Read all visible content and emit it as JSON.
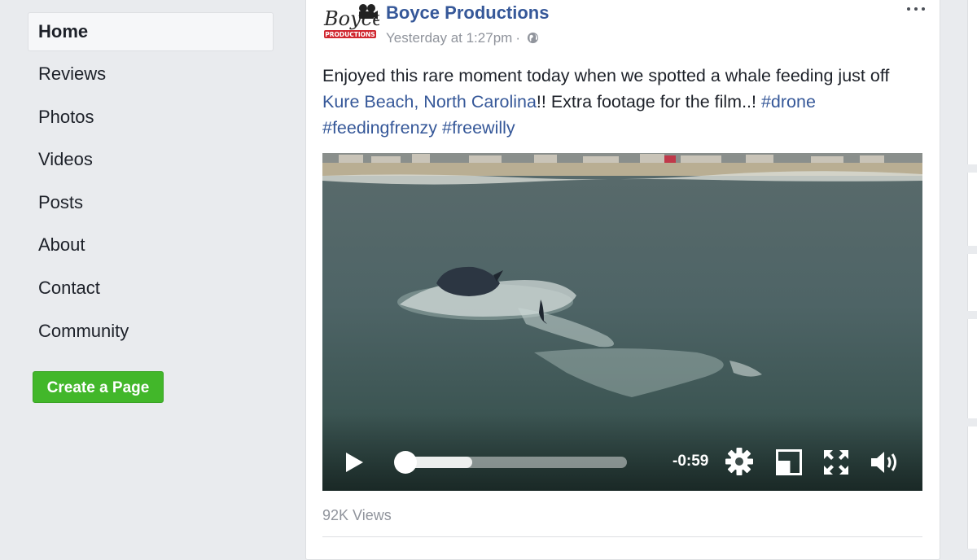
{
  "sidebar": {
    "items": [
      {
        "label": "Home",
        "active": true
      },
      {
        "label": "Reviews"
      },
      {
        "label": "Photos"
      },
      {
        "label": "Videos"
      },
      {
        "label": "Posts"
      },
      {
        "label": "About"
      },
      {
        "label": "Contact"
      },
      {
        "label": "Community"
      }
    ],
    "create_page_label": "Create a Page"
  },
  "post": {
    "page_name": "Boyce Productions",
    "timestamp": "Yesterday at 1:27pm",
    "separator": "·",
    "privacy_icon": "globe-icon",
    "more_icon": "more-options-icon",
    "text_before": "Enjoyed this rare moment today when we spotted a whale feeding just off ",
    "location_link": "Kure Beach, North Carolina",
    "text_after": "!! Extra footage for the film..! ",
    "hashtags": [
      "#drone",
      "#feedingfrenzy",
      "#freewilly"
    ],
    "avatar": {
      "line1": "Boyce",
      "line2": "PRODUCTIONS",
      "icon": "film-camera-icon"
    }
  },
  "video": {
    "time_remaining": "-0:59",
    "progress": 0.0,
    "buffered": 0.3,
    "icons": [
      "play-icon",
      "settings-gear-icon",
      "pop-out-icon",
      "fullscreen-icon",
      "volume-icon"
    ]
  },
  "stats": {
    "views": "92K Views"
  },
  "colors": {
    "link": "#365899",
    "accent_green": "#42b72a",
    "meta": "#90949c"
  }
}
